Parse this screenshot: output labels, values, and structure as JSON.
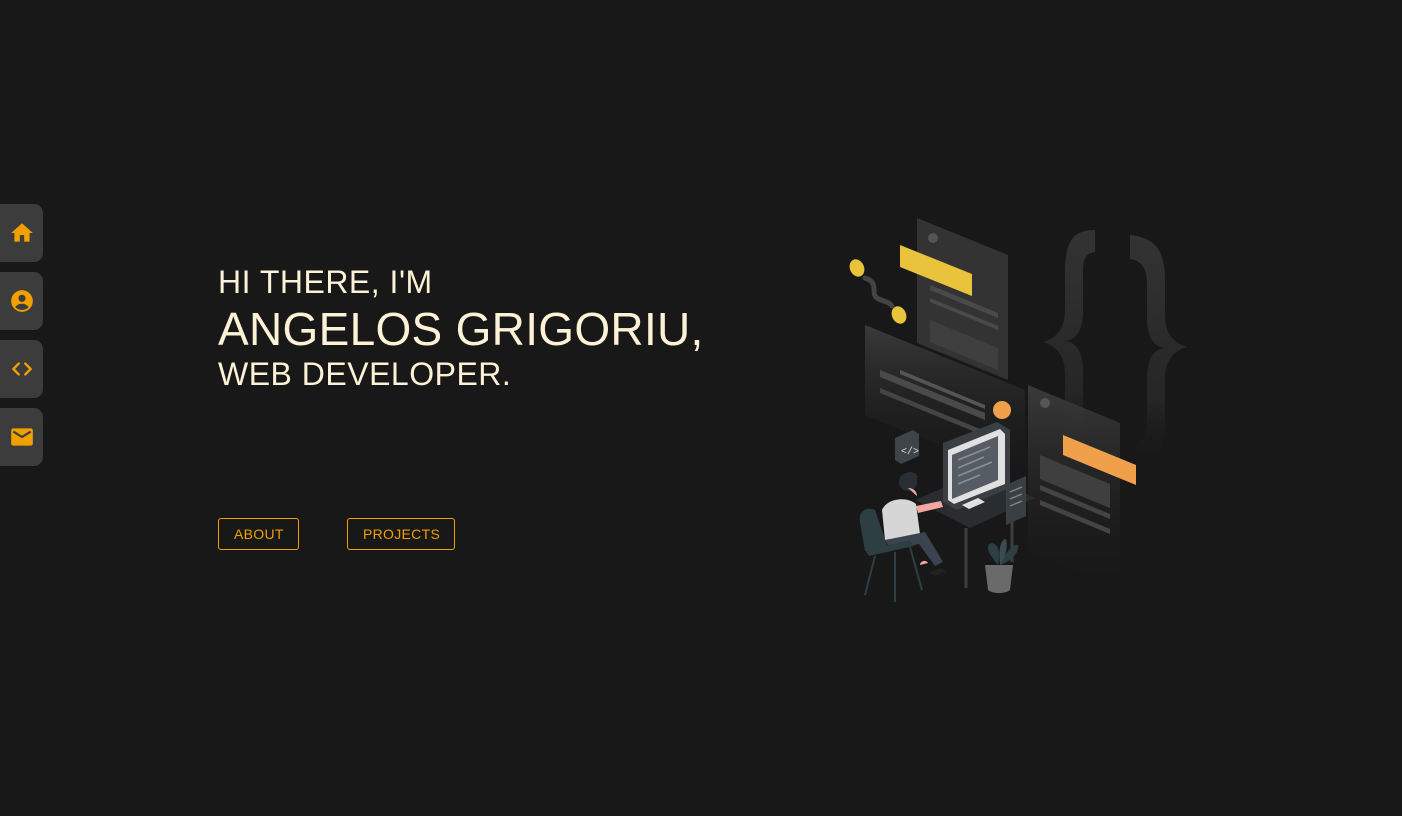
{
  "nav": {
    "items": [
      {
        "name": "home",
        "icon": "home-icon"
      },
      {
        "name": "about",
        "icon": "user-circle-icon"
      },
      {
        "name": "projects",
        "icon": "code-icon"
      },
      {
        "name": "contact",
        "icon": "mail-icon"
      }
    ]
  },
  "hero": {
    "greeting": "HI THERE, I'M",
    "name": "ANGELOS GRIGORIU,",
    "role": "WEB DEVELOPER."
  },
  "buttons": {
    "about_label": "ABOUT",
    "projects_label": "PROJECTS"
  },
  "illustration": {
    "icon": "developer-at-desk-illustration",
    "code_badge": "</>"
  },
  "colors": {
    "background": "#181818",
    "accent": "#f0a000",
    "text": "#fdf2d6",
    "nav_bg": "#3c3c3c"
  }
}
